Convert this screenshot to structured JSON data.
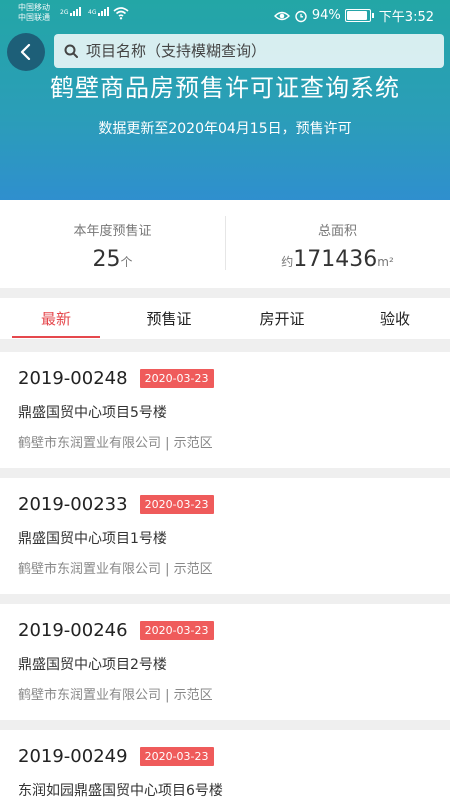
{
  "status_bar": {
    "carrier_1": "中国移动",
    "carrier_2": "中国联通",
    "net_1": "2G",
    "net_2": "4G",
    "battery": "94%",
    "battery_level": 0.94,
    "time": "下午3:52"
  },
  "header": {
    "back_icon": "chevron-left-icon",
    "search_icon": "search-icon",
    "search_placeholder": "项目名称（支持模糊查询）",
    "title": "鹤壁商品房预售许可证查询系统",
    "subtitle": "数据更新至2020年04月15日，预售许可"
  },
  "stats": {
    "left": {
      "label": "本年度预售证",
      "value": "25",
      "unit": "个"
    },
    "right": {
      "label": "总面积",
      "prefix": "约",
      "value": "171436",
      "unit": "m²"
    }
  },
  "tabs": [
    {
      "label": "最新",
      "active": true
    },
    {
      "label": "预售证",
      "active": false
    },
    {
      "label": "房开证",
      "active": false
    },
    {
      "label": "验收",
      "active": false
    }
  ],
  "accent_color": "#e5484d",
  "records": [
    {
      "number": "2019-00248",
      "date": "2020-03-23",
      "name": "鼎盛国贸中心项目5号楼",
      "meta": "鹤壁市东润置业有限公司 | 示范区"
    },
    {
      "number": "2019-00233",
      "date": "2020-03-23",
      "name": "鼎盛国贸中心项目1号楼",
      "meta": "鹤壁市东润置业有限公司 | 示范区"
    },
    {
      "number": "2019-00246",
      "date": "2020-03-23",
      "name": "鼎盛国贸中心项目2号楼",
      "meta": "鹤壁市东润置业有限公司 | 示范区"
    },
    {
      "number": "2019-00249",
      "date": "2020-03-23",
      "name": "东润如园鼎盛国贸中心项目6号楼",
      "meta": ""
    }
  ]
}
